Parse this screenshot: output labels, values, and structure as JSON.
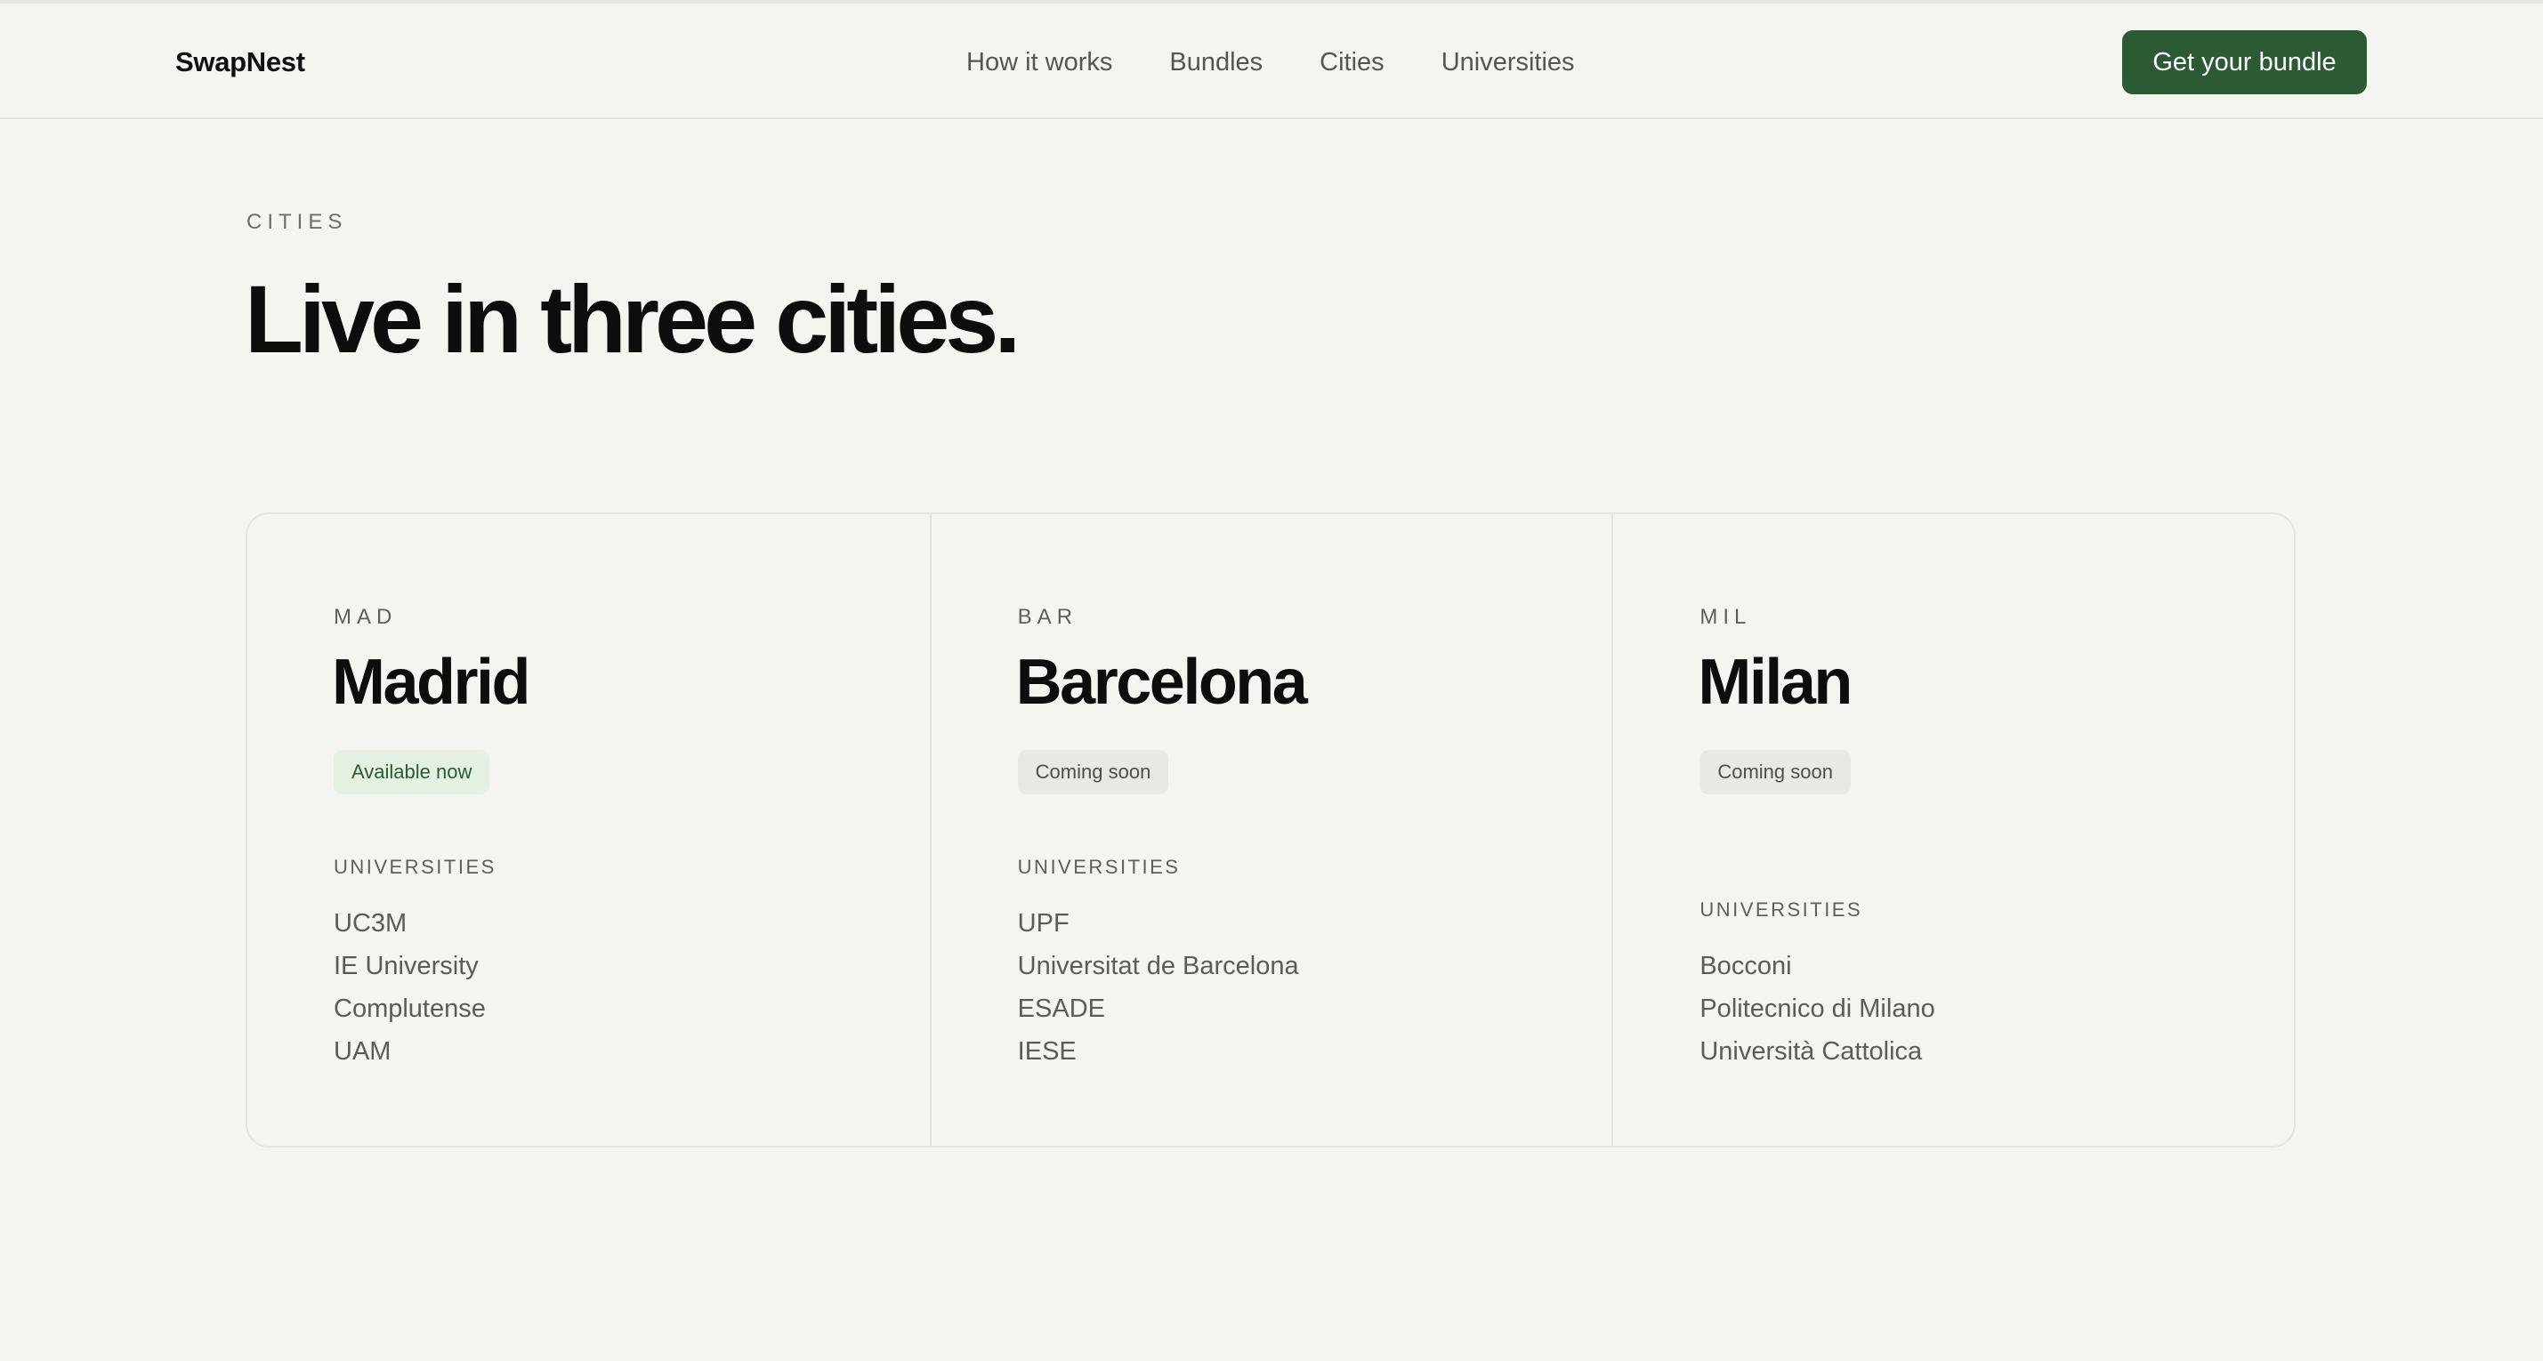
{
  "header": {
    "brand": "SwapNest",
    "nav": [
      {
        "label": "How it works"
      },
      {
        "label": "Bundles"
      },
      {
        "label": "Cities"
      },
      {
        "label": "Universities"
      }
    ],
    "cta_label": "Get your bundle"
  },
  "section": {
    "eyebrow": "CITIES",
    "title": "Live in three cities."
  },
  "cities": [
    {
      "code": "MAD",
      "name": "Madrid",
      "status": "Available now",
      "universities_label": "UNIVERSITIES",
      "universities": [
        "UC3M",
        "IE University",
        "Complutense",
        "UAM"
      ]
    },
    {
      "code": "BAR",
      "name": "Barcelona",
      "status": "Coming soon",
      "universities_label": "UNIVERSITIES",
      "universities": [
        "UPF",
        "Universitat de Barcelona",
        "ESADE",
        "IESE"
      ]
    },
    {
      "code": "MIL",
      "name": "Milan",
      "status": "Coming soon",
      "universities_label": "UNIVERSITIES",
      "universities": [
        "Bocconi",
        "Politecnico di Milano",
        "Università Cattolica"
      ]
    }
  ],
  "colors": {
    "background": "#f4f5f0",
    "accent": "#2c5a34",
    "available_badge_bg": "#e4f0e2",
    "soon_badge_bg": "#e8e8e5"
  }
}
